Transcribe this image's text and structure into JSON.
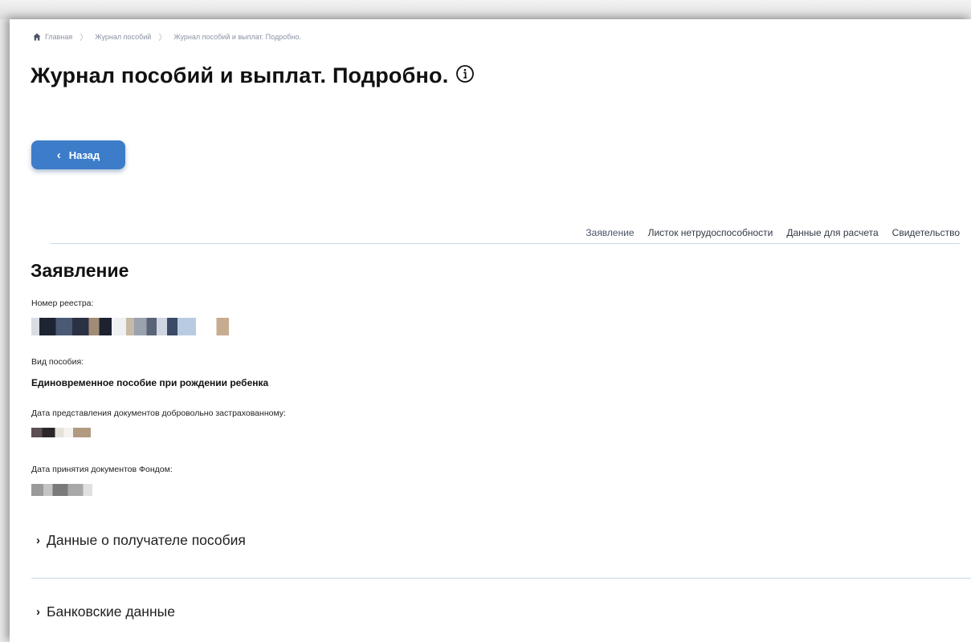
{
  "breadcrumb": {
    "items": [
      "Главная",
      "Журнал пособий",
      "Журнал пособий и выплат. Подробно."
    ]
  },
  "page": {
    "title": "Журнал пособий и выплат. Подробно."
  },
  "back_button": {
    "label": "Назад"
  },
  "tabs": [
    "Заявление",
    "Листок нетрудоспособности",
    "Данные для расчета",
    "Свидетельство"
  ],
  "section": {
    "title": "Заявление",
    "fields": {
      "registry_label": "Номер реестра:",
      "benefit_type_label": "Вид пособия:",
      "benefit_type_value": "Единовременное пособие при рождении ребенка",
      "docs_submitted_label": "Дата представления документов добровольно застрахованному:",
      "docs_accepted_label": "Дата принятия документов Фондом:"
    }
  },
  "collapsibles": [
    "Данные о получателе пособия",
    "Банковские данные"
  ],
  "colors": {
    "accent": "#3d7cc9",
    "divider": "#c9d6ea"
  },
  "icons": [
    "home-icon",
    "info-icon",
    "chevron-left-icon",
    "chevron-right-icon"
  ]
}
